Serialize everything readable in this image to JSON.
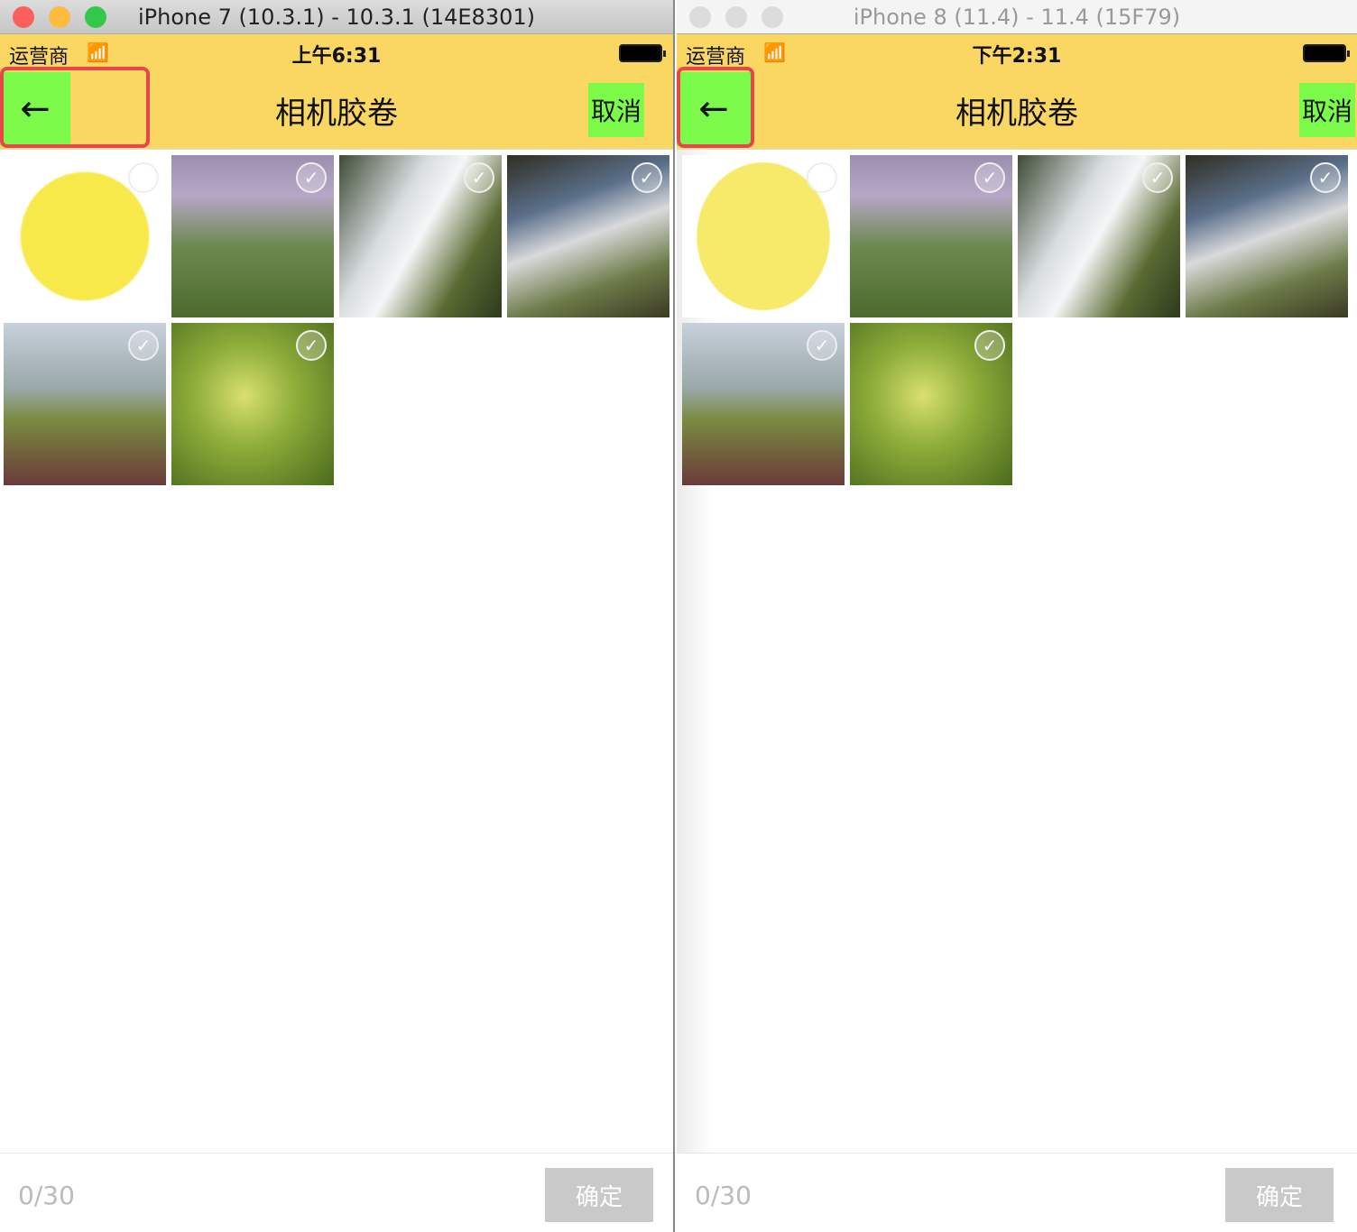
{
  "colors": {
    "nav_bg": "#f9d762",
    "highlight_green": "#7cfa4a",
    "debug_outline": "#e8474a",
    "confirm_disabled": "#c9c9c9"
  },
  "windows": [
    {
      "title": "iPhone 7 (10.3.1) - 10.3.1 (14E8301)",
      "carrier": "运营商",
      "time": "上午6:31",
      "nav_title": "相机胶卷",
      "back_icon": "←",
      "cancel": "取消",
      "count": "0/30",
      "confirm": "确定"
    },
    {
      "title": "iPhone 8 (11.4) - 11.4 (15F79)",
      "carrier": "运营商",
      "time": "下午2:31",
      "nav_title": "相机胶卷",
      "back_icon": "←",
      "cancel": "取消",
      "count": "0/30",
      "confirm": "确定"
    }
  ],
  "photos": [
    "cartoon-sticker",
    "waterfall-cliff",
    "waterfall-closeup",
    "waterfall-coast",
    "grass-flower",
    "green-leaves"
  ]
}
